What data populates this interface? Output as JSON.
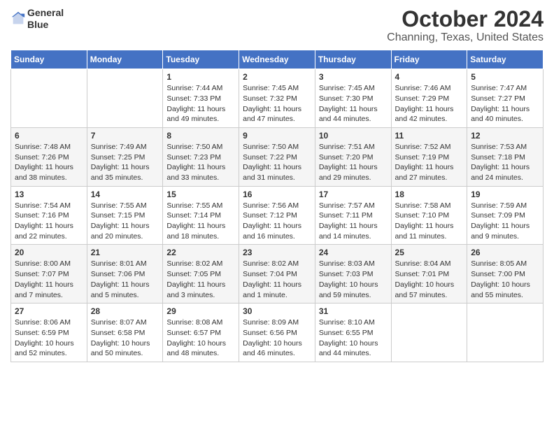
{
  "header": {
    "logo_line1": "General",
    "logo_line2": "Blue",
    "title": "October 2024",
    "subtitle": "Channing, Texas, United States"
  },
  "weekdays": [
    "Sunday",
    "Monday",
    "Tuesday",
    "Wednesday",
    "Thursday",
    "Friday",
    "Saturday"
  ],
  "weeks": [
    [
      {
        "day": "",
        "info": ""
      },
      {
        "day": "",
        "info": ""
      },
      {
        "day": "1",
        "info": "Sunrise: 7:44 AM\nSunset: 7:33 PM\nDaylight: 11 hours and 49 minutes."
      },
      {
        "day": "2",
        "info": "Sunrise: 7:45 AM\nSunset: 7:32 PM\nDaylight: 11 hours and 47 minutes."
      },
      {
        "day": "3",
        "info": "Sunrise: 7:45 AM\nSunset: 7:30 PM\nDaylight: 11 hours and 44 minutes."
      },
      {
        "day": "4",
        "info": "Sunrise: 7:46 AM\nSunset: 7:29 PM\nDaylight: 11 hours and 42 minutes."
      },
      {
        "day": "5",
        "info": "Sunrise: 7:47 AM\nSunset: 7:27 PM\nDaylight: 11 hours and 40 minutes."
      }
    ],
    [
      {
        "day": "6",
        "info": "Sunrise: 7:48 AM\nSunset: 7:26 PM\nDaylight: 11 hours and 38 minutes."
      },
      {
        "day": "7",
        "info": "Sunrise: 7:49 AM\nSunset: 7:25 PM\nDaylight: 11 hours and 35 minutes."
      },
      {
        "day": "8",
        "info": "Sunrise: 7:50 AM\nSunset: 7:23 PM\nDaylight: 11 hours and 33 minutes."
      },
      {
        "day": "9",
        "info": "Sunrise: 7:50 AM\nSunset: 7:22 PM\nDaylight: 11 hours and 31 minutes."
      },
      {
        "day": "10",
        "info": "Sunrise: 7:51 AM\nSunset: 7:20 PM\nDaylight: 11 hours and 29 minutes."
      },
      {
        "day": "11",
        "info": "Sunrise: 7:52 AM\nSunset: 7:19 PM\nDaylight: 11 hours and 27 minutes."
      },
      {
        "day": "12",
        "info": "Sunrise: 7:53 AM\nSunset: 7:18 PM\nDaylight: 11 hours and 24 minutes."
      }
    ],
    [
      {
        "day": "13",
        "info": "Sunrise: 7:54 AM\nSunset: 7:16 PM\nDaylight: 11 hours and 22 minutes."
      },
      {
        "day": "14",
        "info": "Sunrise: 7:55 AM\nSunset: 7:15 PM\nDaylight: 11 hours and 20 minutes."
      },
      {
        "day": "15",
        "info": "Sunrise: 7:55 AM\nSunset: 7:14 PM\nDaylight: 11 hours and 18 minutes."
      },
      {
        "day": "16",
        "info": "Sunrise: 7:56 AM\nSunset: 7:12 PM\nDaylight: 11 hours and 16 minutes."
      },
      {
        "day": "17",
        "info": "Sunrise: 7:57 AM\nSunset: 7:11 PM\nDaylight: 11 hours and 14 minutes."
      },
      {
        "day": "18",
        "info": "Sunrise: 7:58 AM\nSunset: 7:10 PM\nDaylight: 11 hours and 11 minutes."
      },
      {
        "day": "19",
        "info": "Sunrise: 7:59 AM\nSunset: 7:09 PM\nDaylight: 11 hours and 9 minutes."
      }
    ],
    [
      {
        "day": "20",
        "info": "Sunrise: 8:00 AM\nSunset: 7:07 PM\nDaylight: 11 hours and 7 minutes."
      },
      {
        "day": "21",
        "info": "Sunrise: 8:01 AM\nSunset: 7:06 PM\nDaylight: 11 hours and 5 minutes."
      },
      {
        "day": "22",
        "info": "Sunrise: 8:02 AM\nSunset: 7:05 PM\nDaylight: 11 hours and 3 minutes."
      },
      {
        "day": "23",
        "info": "Sunrise: 8:02 AM\nSunset: 7:04 PM\nDaylight: 11 hours and 1 minute."
      },
      {
        "day": "24",
        "info": "Sunrise: 8:03 AM\nSunset: 7:03 PM\nDaylight: 10 hours and 59 minutes."
      },
      {
        "day": "25",
        "info": "Sunrise: 8:04 AM\nSunset: 7:01 PM\nDaylight: 10 hours and 57 minutes."
      },
      {
        "day": "26",
        "info": "Sunrise: 8:05 AM\nSunset: 7:00 PM\nDaylight: 10 hours and 55 minutes."
      }
    ],
    [
      {
        "day": "27",
        "info": "Sunrise: 8:06 AM\nSunset: 6:59 PM\nDaylight: 10 hours and 52 minutes."
      },
      {
        "day": "28",
        "info": "Sunrise: 8:07 AM\nSunset: 6:58 PM\nDaylight: 10 hours and 50 minutes."
      },
      {
        "day": "29",
        "info": "Sunrise: 8:08 AM\nSunset: 6:57 PM\nDaylight: 10 hours and 48 minutes."
      },
      {
        "day": "30",
        "info": "Sunrise: 8:09 AM\nSunset: 6:56 PM\nDaylight: 10 hours and 46 minutes."
      },
      {
        "day": "31",
        "info": "Sunrise: 8:10 AM\nSunset: 6:55 PM\nDaylight: 10 hours and 44 minutes."
      },
      {
        "day": "",
        "info": ""
      },
      {
        "day": "",
        "info": ""
      }
    ]
  ]
}
